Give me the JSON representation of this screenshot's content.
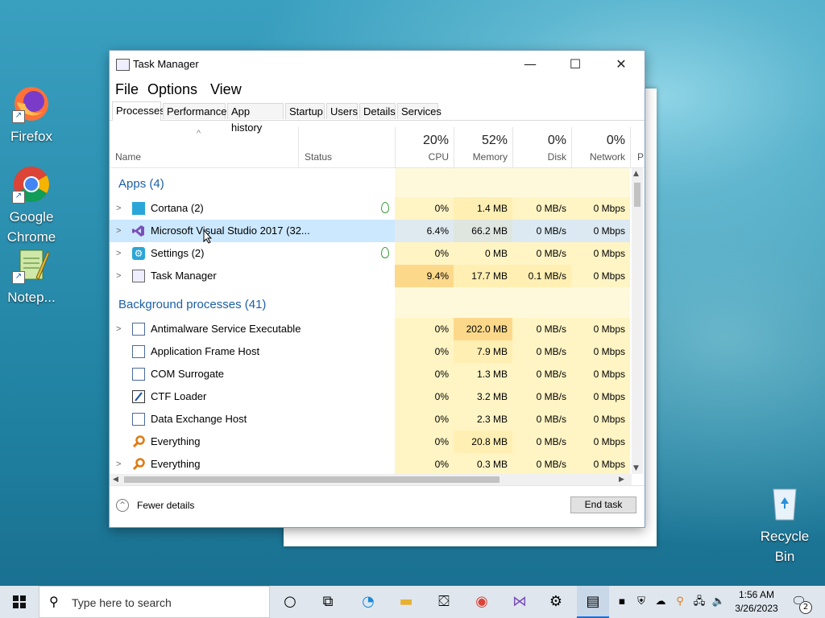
{
  "desktop": {
    "icons": [
      {
        "label": "Firefox"
      },
      {
        "label": "Google Chrome"
      },
      {
        "label": "Notep..."
      },
      {
        "label": "Recycle Bin"
      }
    ]
  },
  "window": {
    "title": "Task Manager",
    "minimize": "—",
    "maximize": "☐",
    "close": "✕"
  },
  "menu": [
    "File",
    "Options",
    "View"
  ],
  "tabs": [
    "Processes",
    "Performance",
    "App history",
    "Startup",
    "Users",
    "Details",
    "Services"
  ],
  "columns": {
    "name": "Name",
    "status": "Status",
    "cpu": {
      "pct": "20%",
      "label": "CPU"
    },
    "memory": {
      "pct": "52%",
      "label": "Memory"
    },
    "disk": {
      "pct": "0%",
      "label": "Disk"
    },
    "network": {
      "pct": "0%",
      "label": "Network"
    },
    "power": "P"
  },
  "groups": {
    "apps": "Apps (4)",
    "background": "Background processes (41)"
  },
  "apps": [
    {
      "name": "Cortana (2)",
      "cpu": "0%",
      "mem": "1.4 MB",
      "disk": "0 MB/s",
      "net": "0 Mbps"
    },
    {
      "name": "Microsoft Visual Studio 2017 (32...",
      "cpu": "6.4%",
      "mem": "66.2 MB",
      "disk": "0 MB/s",
      "net": "0 Mbps"
    },
    {
      "name": "Settings (2)",
      "cpu": "0%",
      "mem": "0 MB",
      "disk": "0 MB/s",
      "net": "0 Mbps"
    },
    {
      "name": "Task Manager",
      "cpu": "9.4%",
      "mem": "17.7 MB",
      "disk": "0.1 MB/s",
      "net": "0 Mbps"
    }
  ],
  "background": [
    {
      "name": "Antimalware Service Executable",
      "cpu": "0%",
      "mem": "202.0 MB",
      "disk": "0 MB/s",
      "net": "0 Mbps"
    },
    {
      "name": "Application Frame Host",
      "cpu": "0%",
      "mem": "7.9 MB",
      "disk": "0 MB/s",
      "net": "0 Mbps"
    },
    {
      "name": "COM Surrogate",
      "cpu": "0%",
      "mem": "1.3 MB",
      "disk": "0 MB/s",
      "net": "0 Mbps"
    },
    {
      "name": "CTF Loader",
      "cpu": "0%",
      "mem": "3.2 MB",
      "disk": "0 MB/s",
      "net": "0 Mbps"
    },
    {
      "name": "Data Exchange Host",
      "cpu": "0%",
      "mem": "2.3 MB",
      "disk": "0 MB/s",
      "net": "0 Mbps"
    },
    {
      "name": "Everything",
      "cpu": "0%",
      "mem": "20.8 MB",
      "disk": "0 MB/s",
      "net": "0 Mbps"
    },
    {
      "name": "Everything",
      "cpu": "0%",
      "mem": "0.3 MB",
      "disk": "0 MB/s",
      "net": "0 Mbps"
    }
  ],
  "footer": {
    "fewer_details": "Fewer details",
    "end_task": "End task"
  },
  "taskbar": {
    "search_placeholder": "Type here to search",
    "time": "1:56 AM",
    "date": "3/26/2023",
    "notifications": "2"
  },
  "colors": {
    "heat_light": "#fff4c4",
    "heat_mid": "#ffe8a0",
    "heat_strong": "#fcd98a",
    "selected_row": "#cce8ff",
    "group_text": "#1c5fa8"
  }
}
